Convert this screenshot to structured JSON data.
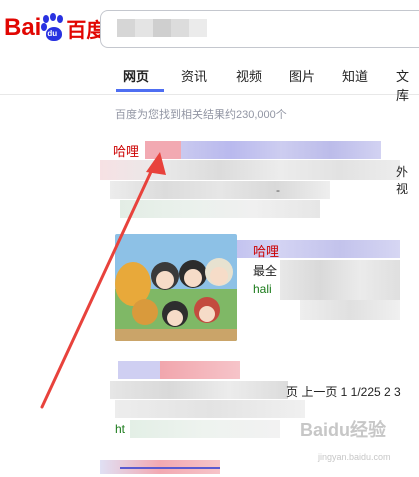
{
  "logo": {
    "text_left": "Bai",
    "paw_text": "du",
    "text_right": "百度"
  },
  "tabs": [
    {
      "label": "网页",
      "active": true
    },
    {
      "label": "资讯",
      "active": false
    },
    {
      "label": "视频",
      "active": false
    },
    {
      "label": "图片",
      "active": false
    },
    {
      "label": "知道",
      "active": false
    },
    {
      "label": "文库",
      "active": false
    }
  ],
  "result_count": "百度为您找到相关结果约230,000个",
  "results": [
    {
      "title_partial": "哈哩",
      "snippet_tail": "外视",
      "snippet_dash": "-"
    },
    {
      "title_partial": "哈哩",
      "desc_partial": "最全",
      "url_partial": "hali"
    },
    {
      "pager_text": "页 上一页 1 1/225 2 3",
      "url_partial": "ht"
    }
  ],
  "watermark": {
    "main": "Baidu经验",
    "sub": "jingyan.baidu.com"
  },
  "colors": {
    "brand_red": "#e10602",
    "brand_blue": "#2932e1",
    "accent": "#4e6ef2",
    "arrow": "#e8423c"
  }
}
